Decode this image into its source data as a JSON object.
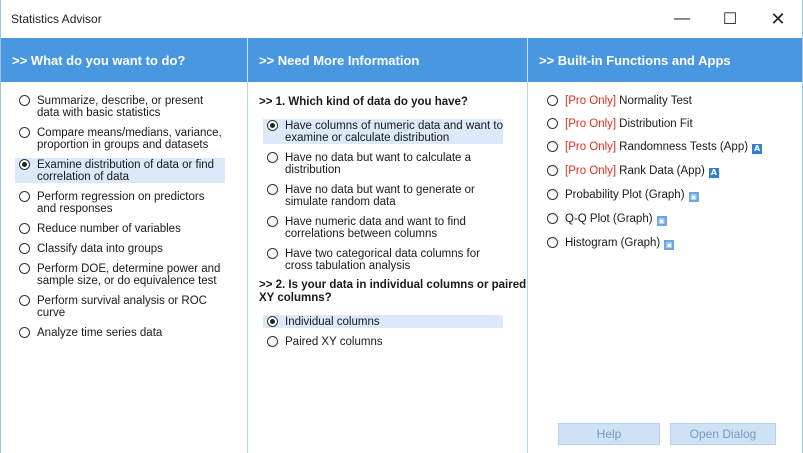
{
  "window": {
    "title": "Statistics Advisor"
  },
  "headers": {
    "what": ">> What do you want to do?",
    "info": ">> Need More Information",
    "builtin": ">> Built-in Functions and Apps"
  },
  "tasks": [
    {
      "label": "Summarize, describe, or present data with basic statistics",
      "selected": false
    },
    {
      "label": "Compare means/medians, variance, proportion in groups and datasets",
      "selected": false
    },
    {
      "label": "Examine distribution of data or find correlation of data",
      "selected": true
    },
    {
      "label": "Perform regression on predictors and responses",
      "selected": false
    },
    {
      "label": "Reduce number of variables",
      "selected": false
    },
    {
      "label": "Classify data into groups",
      "selected": false
    },
    {
      "label": "Perform DOE, determine power and sample size, or do equivalence test",
      "selected": false
    },
    {
      "label": "Perform survival analysis or ROC curve",
      "selected": false
    },
    {
      "label": "Analyze time series data",
      "selected": false
    }
  ],
  "question1": ">> 1. Which kind of data do you have?",
  "data_kinds": [
    {
      "label": "Have columns of numeric data and want to examine or calculate distribution",
      "selected": true
    },
    {
      "label": "Have no data but want to calculate a distribution",
      "selected": false
    },
    {
      "label": "Have no data but want to generate or simulate random data",
      "selected": false
    },
    {
      "label": "Have numeric data and want to find correlations between columns",
      "selected": false
    },
    {
      "label": "Have two categorical data columns for cross tabulation analysis",
      "selected": false
    }
  ],
  "question2": ">> 2. Is your data in individual columns or paired XY columns?",
  "layouts": [
    {
      "label": "Individual columns",
      "selected": true
    },
    {
      "label": "Paired XY columns",
      "selected": false
    }
  ],
  "functions": [
    {
      "pro": "[Pro Only]",
      "label": "Normality Test",
      "badge": ""
    },
    {
      "pro": "[Pro Only]",
      "label": "Distribution Fit",
      "badge": ""
    },
    {
      "pro": "[Pro Only]",
      "label": "Randomness Tests (App)",
      "badge": "A"
    },
    {
      "pro": "[Pro Only]",
      "label": "Rank Data (App)",
      "badge": "A"
    },
    {
      "pro": "",
      "label": "Probability Plot (Graph)",
      "badge": "graph"
    },
    {
      "pro": "",
      "label": "Q-Q Plot (Graph)",
      "badge": "graph"
    },
    {
      "pro": "",
      "label": "Histogram (Graph)",
      "badge": "graph"
    }
  ],
  "buttons": {
    "help": "Help",
    "open": "Open Dialog"
  },
  "colors": {
    "header": "#4a97e1",
    "selection": "#dbe9f8",
    "pro": "#e0301e"
  }
}
